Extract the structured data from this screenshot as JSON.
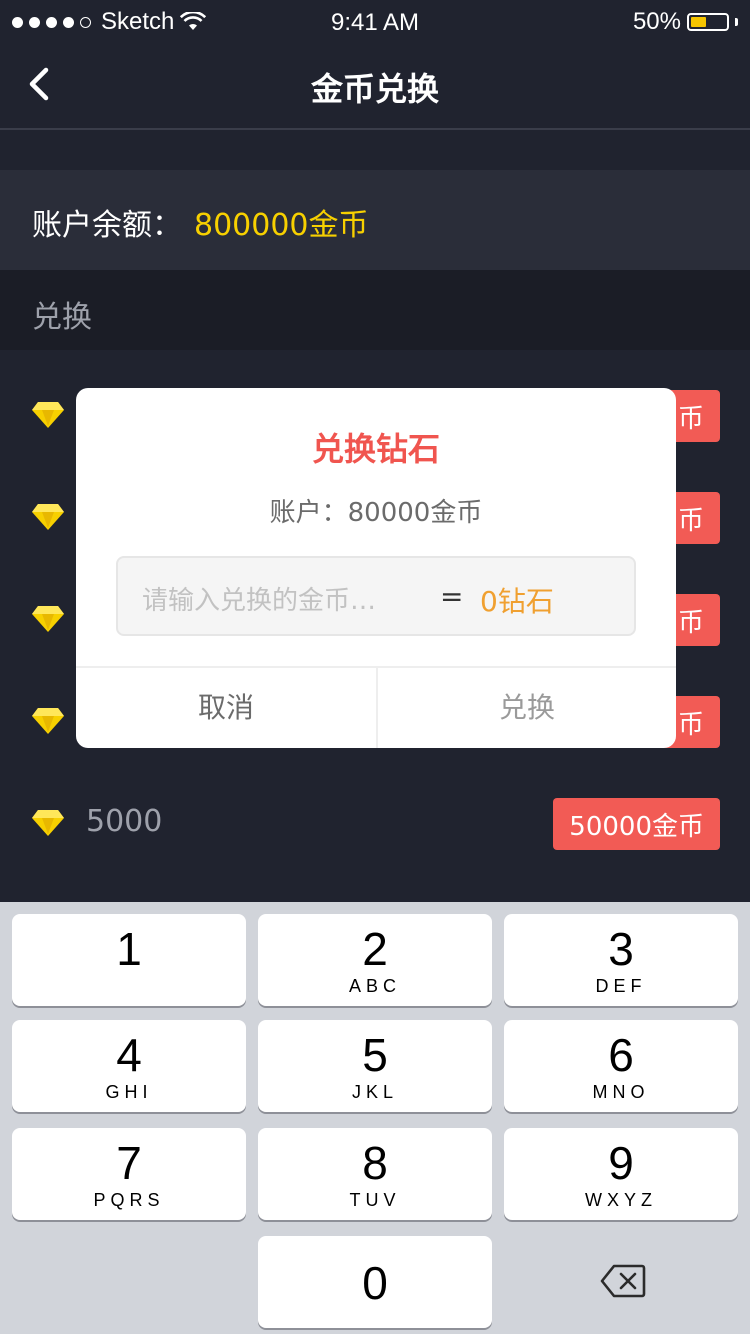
{
  "status_bar": {
    "carrier": "Sketch",
    "time": "9:41 AM",
    "battery": "50%",
    "battery_level": 0.5
  },
  "nav": {
    "title": "金币兑换"
  },
  "balance": {
    "label": "账户余额：",
    "value": "800000金币"
  },
  "section": {
    "label": "兑换"
  },
  "list": {
    "items": [
      {
        "amount": "",
        "price": "币"
      },
      {
        "amount": "",
        "price": "币"
      },
      {
        "amount": "",
        "price": "币"
      },
      {
        "amount": "",
        "price": "币"
      },
      {
        "amount": "5000",
        "price": "50000金币"
      }
    ]
  },
  "dialog": {
    "title": "兑换钻石",
    "account": "账户：80000金币",
    "input_placeholder": "请输入兑换的金币…",
    "equals": "=",
    "result": "0钻石",
    "cancel": "取消",
    "confirm": "兑换"
  },
  "keyboard": {
    "keys": [
      {
        "num": "1",
        "letters": ""
      },
      {
        "num": "2",
        "letters": "ABC"
      },
      {
        "num": "3",
        "letters": "DEF"
      },
      {
        "num": "4",
        "letters": "GHI"
      },
      {
        "num": "5",
        "letters": "JKL"
      },
      {
        "num": "6",
        "letters": "MNO"
      },
      {
        "num": "7",
        "letters": "PQRS"
      },
      {
        "num": "8",
        "letters": "TUV"
      },
      {
        "num": "9",
        "letters": "WXYZ"
      },
      {
        "num": "0",
        "letters": ""
      }
    ]
  },
  "icons": {
    "back": "chevron-left-icon",
    "wifi": "wifi-icon",
    "gem": "diamond-icon",
    "delete": "backspace-icon"
  },
  "colors": {
    "background": "#20232f",
    "accent_red": "#f25b55",
    "balance_yellow": "#f7d000",
    "result_orange": "#f0a030"
  }
}
